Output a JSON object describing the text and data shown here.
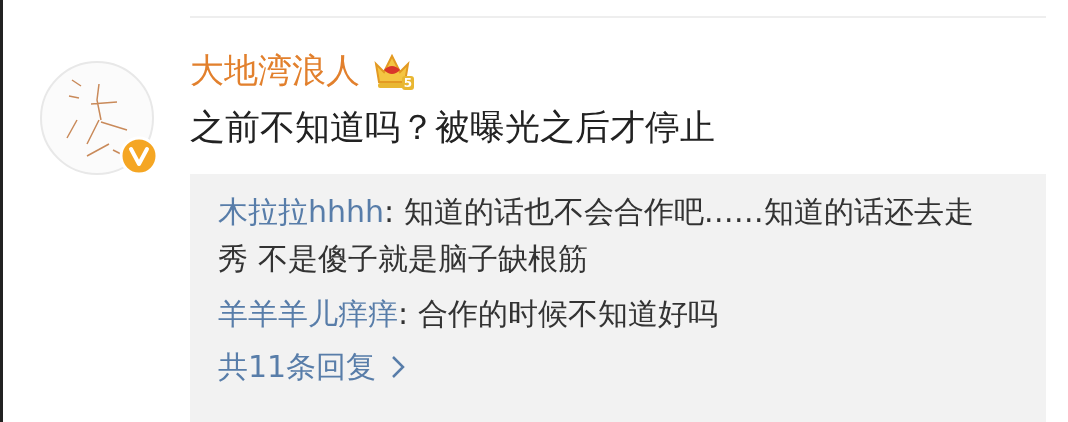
{
  "comment": {
    "author": "大地湾浪人",
    "member_level": "5",
    "verified": true,
    "text": "之前不知道吗？被曝光之后才停止",
    "replies": [
      {
        "author": "木拉拉hhhh",
        "text": ": 知道的话也不会合作吧……知道的话还去走秀 不是傻子就是脑子缺根筋"
      },
      {
        "author": "羊羊羊儿痒痒",
        "text": ": 合作的时候不知道好吗"
      }
    ],
    "more_replies": "共11条回复"
  }
}
